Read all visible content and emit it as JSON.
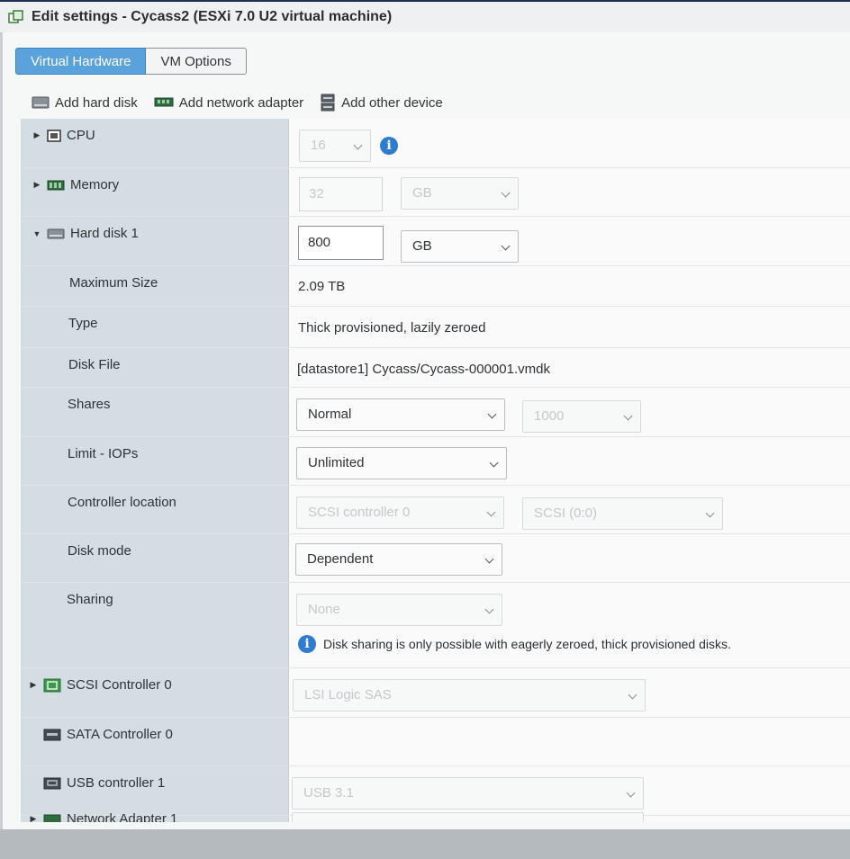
{
  "window": {
    "title": "Edit settings - Cycass2 (ESXi 7.0 U2 virtual machine)"
  },
  "tabs": [
    {
      "label": "Virtual Hardware",
      "active": true
    },
    {
      "label": "VM Options",
      "active": false
    }
  ],
  "toolbar": {
    "add_hard_disk": "Add hard disk",
    "add_network_adapter": "Add network adapter",
    "add_other_device": "Add other device"
  },
  "hardware": {
    "cpu": {
      "label": "CPU",
      "value": "16"
    },
    "memory": {
      "label": "Memory",
      "value": "32",
      "unit": "GB"
    },
    "hard_disk": {
      "label": "Hard disk 1",
      "size": "800",
      "unit": "GB",
      "max_size": {
        "label": "Maximum Size",
        "value": "2.09 TB"
      },
      "type": {
        "label": "Type",
        "value": "Thick provisioned, lazily zeroed"
      },
      "disk_file": {
        "label": "Disk File",
        "value": "[datastore1] Cycass/Cycass-000001.vmdk"
      },
      "shares": {
        "label": "Shares",
        "value": "Normal",
        "amount": "1000"
      },
      "limit_iops": {
        "label": "Limit - IOPs",
        "value": "Unlimited"
      },
      "controller_location": {
        "label": "Controller location",
        "controller": "SCSI controller 0",
        "slot": "SCSI (0:0)"
      },
      "disk_mode": {
        "label": "Disk mode",
        "value": "Dependent"
      },
      "sharing": {
        "label": "Sharing",
        "value": "None",
        "info": "Disk sharing is only possible with eagerly zeroed, thick provisioned disks."
      }
    },
    "scsi_controller": {
      "label": "SCSI Controller 0",
      "value": "LSI Logic SAS"
    },
    "sata_controller": {
      "label": "SATA Controller 0"
    },
    "usb_controller": {
      "label": "USB controller 1",
      "value": "USB 3.1"
    },
    "network_adapter": {
      "label": "Network Adapter 1"
    }
  },
  "colors": {
    "active_tab": "#5aa2dc",
    "label_column": "#d4dde3",
    "info_blue": "#2f7bd0",
    "title_strip": "#1d2f52"
  }
}
